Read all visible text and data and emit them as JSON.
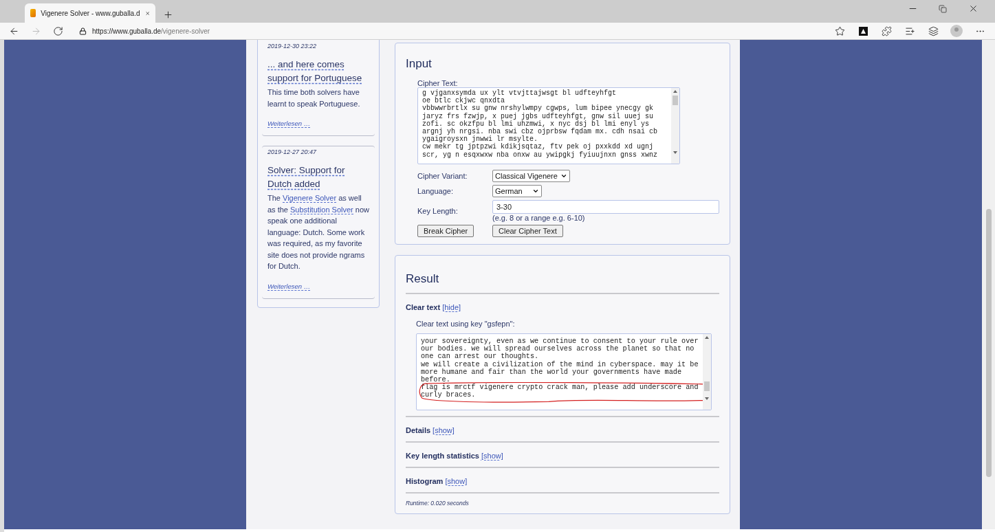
{
  "browser": {
    "tab_title": "Vigenere Solver - www.guballa.d",
    "address_host": "https://www.guballa.de",
    "address_path": "/vigenere-solver"
  },
  "sidebar": {
    "posts": [
      {
        "date": "2019-12-30 23:22",
        "title": "... and here comes support for Portuguese",
        "body": [
          {
            "kind": "text",
            "text": "This time both solvers have learnt to speak Portuguese."
          }
        ],
        "more": "Weiterlesen …"
      },
      {
        "date": "2019-12-27 20:47",
        "title": "Solver: Support for Dutch added",
        "body": [
          {
            "kind": "text",
            "text": "The "
          },
          {
            "kind": "link",
            "text": "Vigenere Solver"
          },
          {
            "kind": "text",
            "text": " as well as the "
          },
          {
            "kind": "link",
            "text": "Substitution Solver"
          },
          {
            "kind": "text",
            "text": " now speak one additional language: Dutch. Some work was required, as my favorite site does not provide ngrams for Dutch."
          }
        ],
        "more": "Weiterlesen …"
      }
    ]
  },
  "input": {
    "title": "Input",
    "cipher_label": "Cipher Text:",
    "cipher_lines": [
      "g vjganxsymda ux ylt vtvjttajwsgt bl udfteyhfgt",
      "oe btlc ckjwc qnxdta",
      "vbbwwrbrtlx su gnw nrshylwmpy cgwps, lum bipee ynecgy gk",
      "jaryz frs fzwjp, x puej jgbs udfteyhfgt, gnw sil uuej su",
      "zofi. sc okzfpu bl lmi uhzmwi, x nyc dsj bl lmi enyl ys",
      "argnj yh nrgsi. nba swi cbz ojprbsw fqdam mx. cdh nsai cb",
      "ygaigroysxn jnwwi lr msylte.",
      "cw mekr tg jptpzwi kdikjsqtaz, ftv pek oj pxxkdd xd ugnj",
      "scr, yg n esqxwxw nba onxw au ywipgkj fyiuujnxn gnss xwnz"
    ],
    "variant": {
      "label": "Cipher Variant:",
      "value": "Classical Vigenere"
    },
    "language": {
      "label": "Language:",
      "value": "German"
    },
    "key_length": {
      "label": "Key Length:",
      "value": "3-30",
      "hint": "(e.g. 8 or a range e.g. 6-10)"
    },
    "buttons": [
      "Break Cipher",
      "Clear Cipher Text"
    ]
  },
  "result": {
    "title": "Result",
    "sections": [
      {
        "label": "Clear text",
        "toggle": "[hide]",
        "expanded": true,
        "key_label": "Clear text using key \"gsfepn\":",
        "lines": [
          {
            "text": "your sovereignty, even as we continue to consent to your rule over",
            "circled": false
          },
          {
            "text": "our bodies. we will spread ourselves across the planet so that no",
            "circled": false
          },
          {
            "text": "one can arrest our thoughts.",
            "circled": false
          },
          {
            "text": "we will create a civilization of the mind in cyberspace. may it be",
            "circled": false
          },
          {
            "text": "more humane and fair than the world your governments have made",
            "circled": false
          },
          {
            "text": "before.",
            "circled": false
          },
          {
            "text": "flag is mrctf vigenere crypto crack man, please add underscore and",
            "circled": true
          },
          {
            "text": "curly braces.",
            "circled": true
          }
        ]
      },
      {
        "label": "Details",
        "toggle": "[show]"
      },
      {
        "label": "Key length statistics",
        "toggle": "[show]"
      },
      {
        "label": "Histogram",
        "toggle": "[show]"
      }
    ],
    "runtime": "Runtime: 0.020 seconds"
  }
}
